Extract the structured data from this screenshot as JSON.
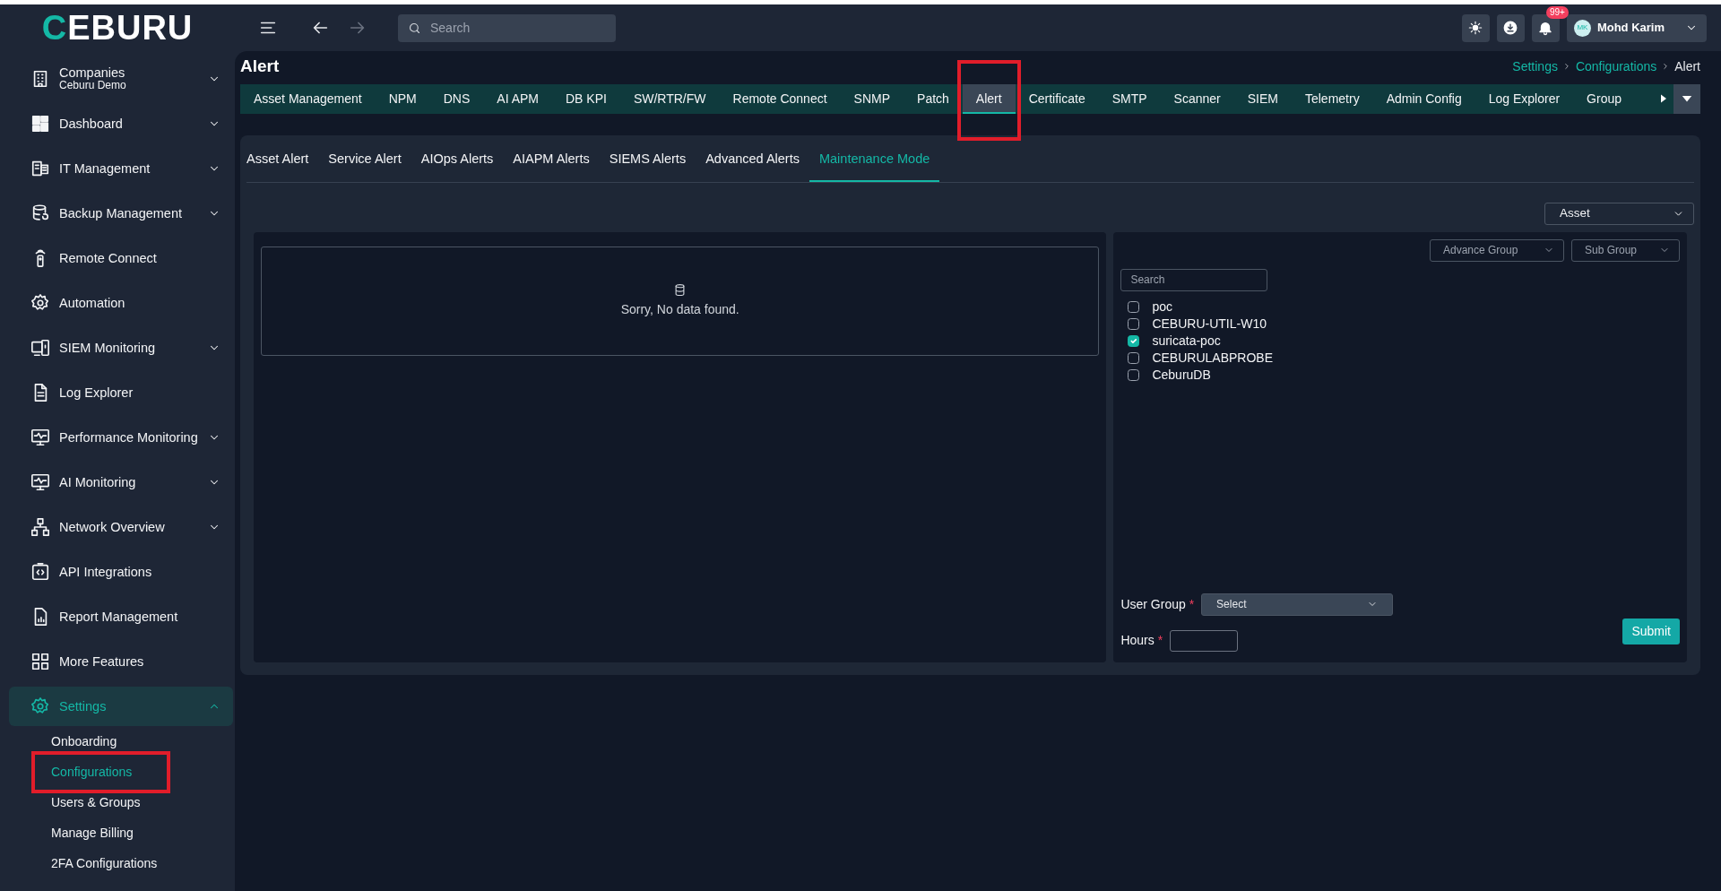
{
  "brand": {
    "logo": "CEBURU"
  },
  "topbar": {
    "search_placeholder": "Search",
    "notifications": "99+",
    "user": {
      "initials": "MK",
      "name": "Mohd Karim"
    }
  },
  "sidebar": {
    "items": [
      {
        "label": "Companies",
        "sublabel": "Ceburu Demo",
        "expanded": false,
        "selected": false
      },
      {
        "label": "Dashboard",
        "expanded": false,
        "selected": false
      },
      {
        "label": "IT Management",
        "expanded": false,
        "selected": false
      },
      {
        "label": "Backup Management",
        "expanded": false,
        "selected": false
      },
      {
        "label": "Remote Connect",
        "selected": false
      },
      {
        "label": "Automation",
        "selected": false
      },
      {
        "label": "SIEM Monitoring",
        "expanded": false,
        "selected": false
      },
      {
        "label": "Log Explorer",
        "selected": false
      },
      {
        "label": "Performance Monitoring",
        "expanded": false,
        "selected": false
      },
      {
        "label": "AI Monitoring",
        "expanded": false,
        "selected": false
      },
      {
        "label": "Network Overview",
        "expanded": false,
        "selected": false
      },
      {
        "label": "API Integrations",
        "selected": false
      },
      {
        "label": "Report Management",
        "selected": false
      },
      {
        "label": "More Features",
        "selected": false
      },
      {
        "label": "Settings",
        "expanded": true,
        "selected": true,
        "children": [
          {
            "label": "Onboarding",
            "selected": false,
            "highlighted": false
          },
          {
            "label": "Configurations",
            "selected": true,
            "highlighted": true
          },
          {
            "label": "Users & Groups",
            "selected": false,
            "highlighted": false
          },
          {
            "label": "Manage Billing",
            "selected": false,
            "highlighted": false
          },
          {
            "label": "2FA Configurations",
            "selected": false,
            "highlighted": false
          }
        ]
      }
    ]
  },
  "page": {
    "title": "Alert",
    "breadcrumb": [
      "Settings",
      "Configurations",
      "Alert"
    ]
  },
  "module_tabs": [
    {
      "label": "Asset Management",
      "selected": false,
      "highlighted": false
    },
    {
      "label": "NPM",
      "selected": false,
      "highlighted": false
    },
    {
      "label": "DNS",
      "selected": false,
      "highlighted": false
    },
    {
      "label": "AI APM",
      "selected": false,
      "highlighted": false
    },
    {
      "label": "DB KPI",
      "selected": false,
      "highlighted": false
    },
    {
      "label": "SW/RTR/FW",
      "selected": false,
      "highlighted": false
    },
    {
      "label": "Remote Connect",
      "selected": false,
      "highlighted": false
    },
    {
      "label": "SNMP",
      "selected": false,
      "highlighted": false
    },
    {
      "label": "Patch",
      "selected": false,
      "highlighted": false
    },
    {
      "label": "Alert",
      "selected": true,
      "highlighted": true
    },
    {
      "label": "Certificate",
      "selected": false,
      "highlighted": false
    },
    {
      "label": "SMTP",
      "selected": false,
      "highlighted": false
    },
    {
      "label": "Scanner",
      "selected": false,
      "highlighted": false
    },
    {
      "label": "SIEM",
      "selected": false,
      "highlighted": false
    },
    {
      "label": "Telemetry",
      "selected": false,
      "highlighted": false
    },
    {
      "label": "Admin Config",
      "selected": false,
      "highlighted": false
    },
    {
      "label": "Log Explorer",
      "selected": false,
      "highlighted": false
    },
    {
      "label": "Group",
      "selected": false,
      "highlighted": false
    }
  ],
  "alert_tabs": [
    {
      "label": "Asset Alert",
      "selected": false
    },
    {
      "label": "Service Alert",
      "selected": false
    },
    {
      "label": "AIOps Alerts",
      "selected": false
    },
    {
      "label": "AIAPM Alerts",
      "selected": false
    },
    {
      "label": "SIEMS Alerts",
      "selected": false
    },
    {
      "label": "Advanced Alerts",
      "selected": false
    },
    {
      "label": "Maintenance Mode",
      "selected": true
    }
  ],
  "asset_type": {
    "value": "Asset"
  },
  "empty_state": {
    "message": "Sorry, No data found."
  },
  "filters": [
    {
      "placeholder": "Advance Group"
    },
    {
      "placeholder": "Sub Group"
    }
  ],
  "asset_search": {
    "placeholder": "Search"
  },
  "assets": [
    {
      "name": "poc",
      "checked": false
    },
    {
      "name": "CEBURU-UTIL-W10",
      "checked": false
    },
    {
      "name": "suricata-poc",
      "checked": true
    },
    {
      "name": "CEBURULABPROBE",
      "checked": false
    },
    {
      "name": "CeburuDB",
      "checked": false
    }
  ],
  "user_group": {
    "label": "User Group",
    "required_mark": "*",
    "placeholder": "Select"
  },
  "hours": {
    "label": "Hours",
    "required_mark": "*"
  },
  "submit": "Submit"
}
